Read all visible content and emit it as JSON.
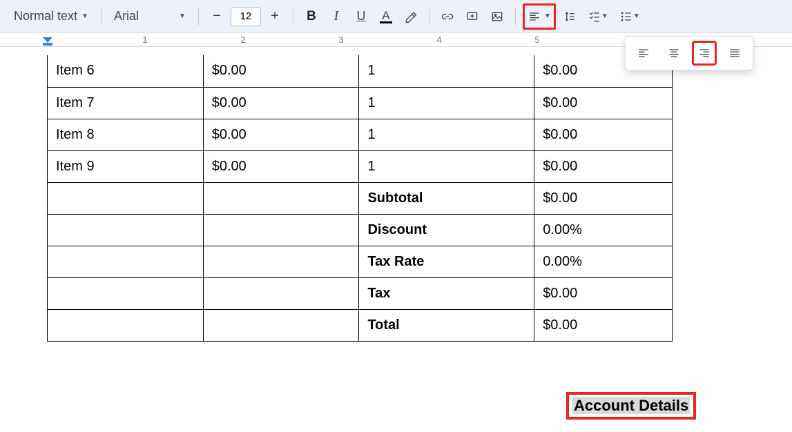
{
  "toolbar": {
    "style_dropdown": "Normal text",
    "font_dropdown": "Arial",
    "font_size": "12",
    "bold": "B",
    "italic": "I",
    "underline": "U",
    "text_color_letter": "A"
  },
  "ruler": {
    "marks": [
      "1",
      "2",
      "3",
      "4",
      "5"
    ]
  },
  "table": {
    "rows": [
      {
        "c1": "Item 6",
        "c2": "$0.00",
        "c3": "1",
        "c4": "$0.00",
        "bold": false
      },
      {
        "c1": "Item 7",
        "c2": "$0.00",
        "c3": "1",
        "c4": "$0.00",
        "bold": false
      },
      {
        "c1": "Item 8",
        "c2": "$0.00",
        "c3": "1",
        "c4": "$0.00",
        "bold": false
      },
      {
        "c1": "Item 9",
        "c2": "$0.00",
        "c3": "1",
        "c4": "$0.00",
        "bold": false
      },
      {
        "c1": "",
        "c2": "",
        "c3": "Subtotal",
        "c4": "$0.00",
        "bold": true
      },
      {
        "c1": "",
        "c2": "",
        "c3": "Discount",
        "c4": "0.00%",
        "bold": true
      },
      {
        "c1": "",
        "c2": "",
        "c3": "Tax Rate",
        "c4": "0.00%",
        "bold": true
      },
      {
        "c1": "",
        "c2": "",
        "c3": "Tax",
        "c4": "$0.00",
        "bold": true
      },
      {
        "c1": "",
        "c2": "",
        "c3": "Total",
        "c4": "$0.00",
        "bold": true
      }
    ]
  },
  "heading": "Account Details"
}
